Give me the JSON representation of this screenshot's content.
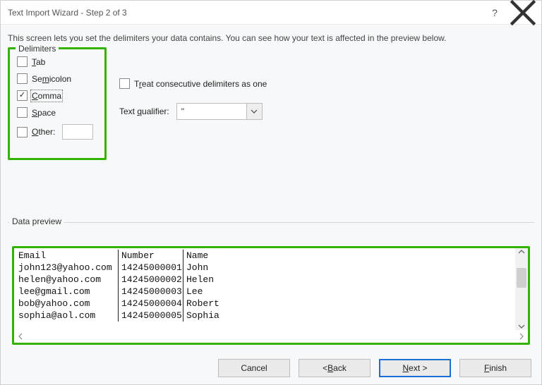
{
  "title": "Text Import Wizard - Step 2 of 3",
  "description": "This screen lets you set the delimiters your data contains.  You can see how your text is affected in the preview below.",
  "delimiters": {
    "legend": "Delimiters",
    "tab": {
      "label": "Tab",
      "checked": false
    },
    "semicolon": {
      "label": "Semicolon",
      "checked": false
    },
    "comma": {
      "label": "Comma",
      "checked": true
    },
    "space": {
      "label": "Space",
      "checked": false
    },
    "other": {
      "label": "Other:",
      "checked": false,
      "value": ""
    }
  },
  "treat_consecutive": {
    "label": "Treat consecutive delimiters as one",
    "checked": false
  },
  "text_qualifier": {
    "label": "Text qualifier:",
    "value": "\""
  },
  "data_preview": {
    "legend": "Data preview",
    "headers": [
      "Email",
      "Number",
      "Name"
    ],
    "rows": [
      [
        "john123@yahoo.com",
        "14245000001",
        "John"
      ],
      [
        "helen@yahoo.com",
        "14245000002",
        "Helen"
      ],
      [
        "lee@gmail.com",
        "14245000003",
        "Lee"
      ],
      [
        "bob@yahoo.com",
        "14245000004",
        "Robert"
      ],
      [
        "sophia@aol.com",
        "14245000005",
        "Sophia"
      ]
    ]
  },
  "buttons": {
    "cancel": "Cancel",
    "back": "< Back",
    "next": "Next >",
    "finish": "Finish"
  }
}
